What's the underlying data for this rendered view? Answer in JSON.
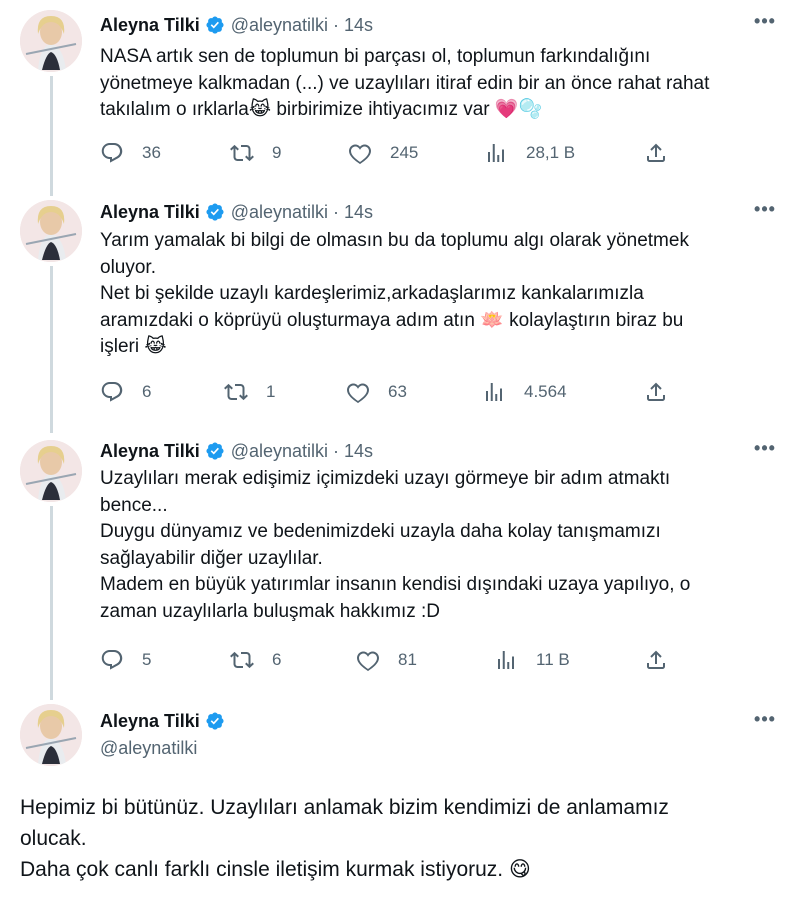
{
  "tweets": [
    {
      "name": "Aleyna Tilki",
      "handle": "@aleynatilki",
      "separator": "·",
      "time": "14s",
      "lines": [
        "NASA artık sen de toplumun bi parçası ol, toplumun farkındalığını",
        "yönetmeye kalkmadan (...) ve uzaylıları itiraf edin bir an önce rahat rahat",
        "takılalım o ırklarla😹 birbirimize ihtiyacımız var 💗🫧"
      ],
      "replies": "36",
      "retweets": "9",
      "likes": "245",
      "views": "28,1 B"
    },
    {
      "name": "Aleyna Tilki",
      "handle": "@aleynatilki",
      "separator": "·",
      "time": "14s",
      "lines": [
        "Yarım yamalak bi bilgi de olmasın bu da toplumu algı olarak yönetmek",
        "oluyor.",
        "Net bi şekilde uzaylı kardeşlerimiz,arkadaşlarımız kankalarımızla",
        "aramızdaki o köprüyü oluşturmaya adım atın 🪷 kolaylaştırın biraz bu",
        "işleri 😹"
      ],
      "replies": "6",
      "retweets": "1",
      "likes": "63",
      "views": "4.564"
    },
    {
      "name": "Aleyna Tilki",
      "handle": "@aleynatilki",
      "separator": "·",
      "time": "14s",
      "lines": [
        "Uzaylıları merak edişimiz içimizdeki uzayı görmeye  bir adım atmaktı",
        "bence...",
        "Duygu dünyamız ve bedenimizdeki uzayla daha kolay tanışmamızı",
        "sağlayabilir diğer uzaylılar.",
        "Madem en büyük yatırımlar insanın kendisi dışındaki uzaya yapılıyo, o",
        "zaman uzaylılarla buluşmak hakkımız :D"
      ],
      "replies": "5",
      "retweets": "6",
      "likes": "81",
      "views": "11 B"
    }
  ],
  "main_tweet": {
    "name": "Aleyna Tilki",
    "handle": "@aleynatilki",
    "lines": [
      "Hepimiz bi bütünüz. Uzaylıları anlamak bizim kendimizi de anlamamız",
      "olucak.",
      "Daha çok canlı farklı cinsle iletişim kurmak istiyoruz.  😋"
    ]
  },
  "more_label": "•••",
  "colors": {
    "text": "#0f1419",
    "muted": "#536471",
    "verified": "#1d9bf0",
    "thread_line": "#cfd9de"
  },
  "icons": [
    "reply-icon",
    "retweet-icon",
    "like-icon",
    "views-icon",
    "share-icon",
    "verified-badge-icon",
    "more-icon"
  ]
}
